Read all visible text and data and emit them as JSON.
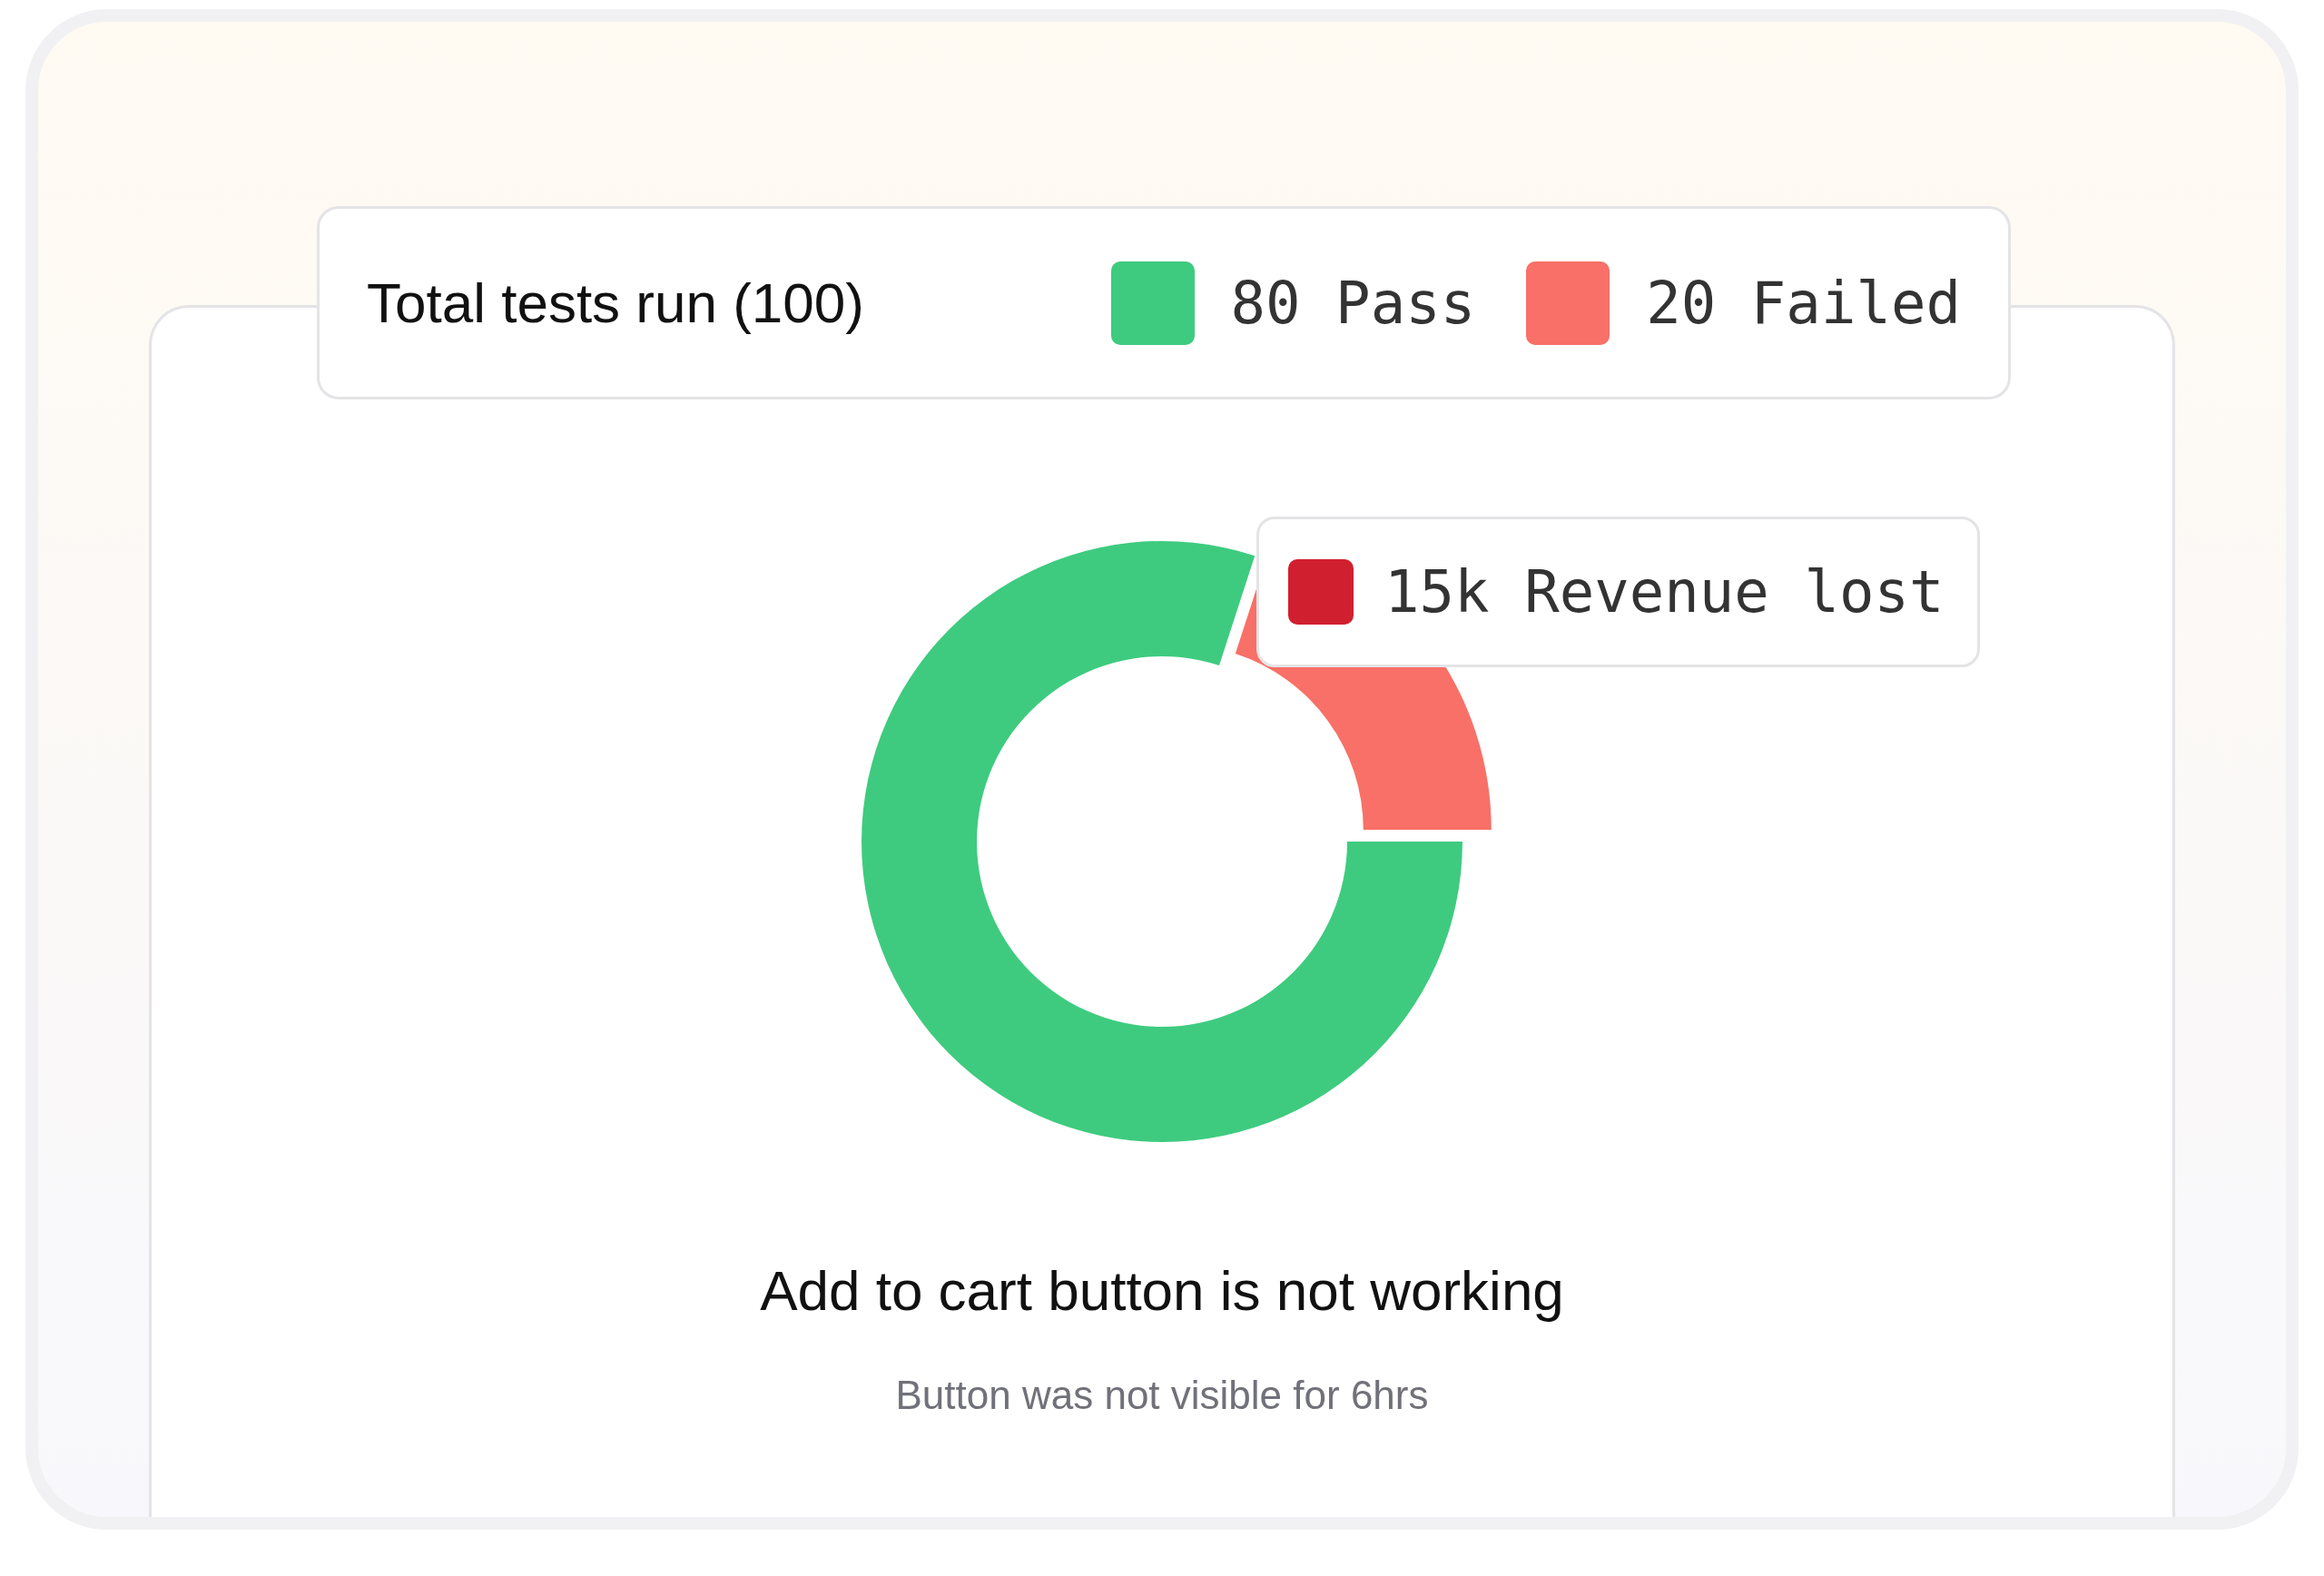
{
  "legend": {
    "title": "Total tests run (100)",
    "items": [
      {
        "label": "80 Pass",
        "color": "#3ecb7f"
      },
      {
        "label": "20 Failed",
        "color": "#f87067"
      }
    ]
  },
  "chart_data": {
    "type": "donut",
    "values": [
      80,
      20
    ]
  },
  "tooltip": {
    "label": "15k Revenue lost",
    "color": "#d0202f"
  },
  "issue": {
    "title": "Add to cart button is not working",
    "subtitle": "Button was not visible for 6hrs"
  }
}
